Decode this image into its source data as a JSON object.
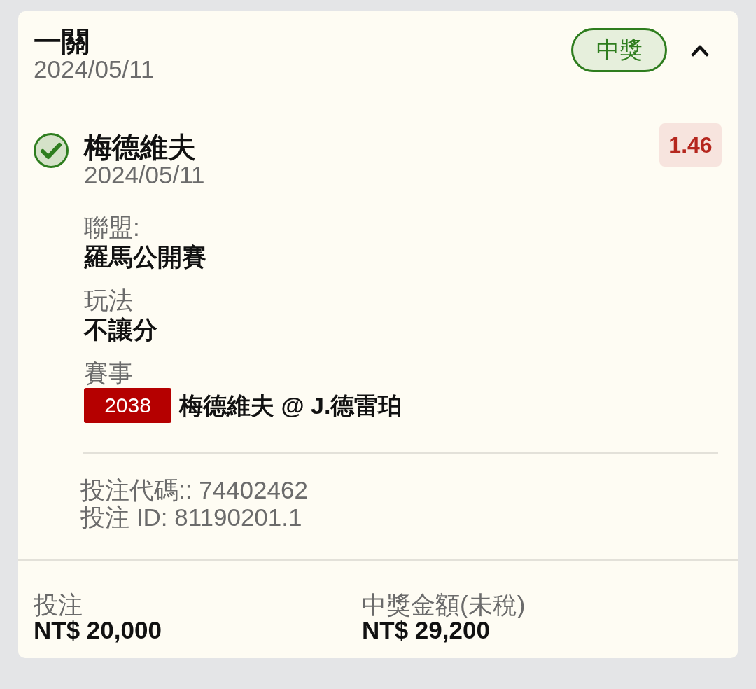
{
  "bet": {
    "type": "一關",
    "date": "2024/05/11",
    "status": {
      "label": "中獎",
      "kind": "won"
    },
    "expanded": true
  },
  "selection": {
    "won": true,
    "name": "梅德維夫",
    "date": "2024/05/11",
    "odds": "1.46"
  },
  "details": [
    {
      "label": "聯盟:",
      "value": "羅馬公開賽"
    },
    {
      "label": "玩法",
      "value": "不讓分"
    }
  ],
  "event": {
    "label": "賽事",
    "number": "2038",
    "teams": "梅德維夫 @ J.德雷珀"
  },
  "references": [
    "投注代碼:: 74402462",
    "投注 ID: 81190201.1"
  ],
  "summary": [
    {
      "label": "投注",
      "value": "NT$ 20,000"
    },
    {
      "label": "中獎金額(未稅)",
      "value": "NT$ 29,200"
    }
  ]
}
